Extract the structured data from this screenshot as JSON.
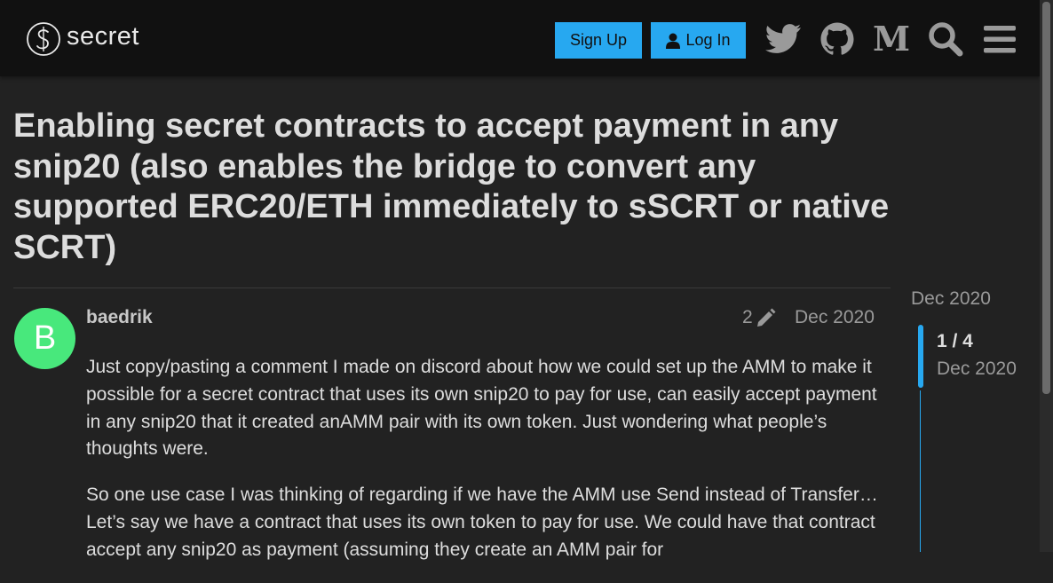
{
  "header": {
    "logo_text": "secret",
    "signup_label": "Sign Up",
    "login_label": "Log In",
    "icons": [
      "twitter-icon",
      "github-icon",
      "medium-icon",
      "search-icon",
      "hamburger-menu-icon"
    ]
  },
  "topic": {
    "title": "Enabling secret contracts to accept payment in any snip20 (also enables the bridge to convert any supported ERC20/ETH immediately to sSCRT or native SCRT)"
  },
  "post": {
    "avatar_letter": "B",
    "username": "baedrik",
    "edit_count": "2",
    "date": "Dec 2020",
    "paragraphs": [
      "Just copy/pasting a comment I made on discord about how we could set up the AMM to make it possible for a secret contract that uses its own snip20 to pay for use, can easily accept payment in any snip20 that it created anAMM pair with its own token. Just wondering what people’s thoughts were.",
      "So one use case I was thinking of regarding if we have the AMM use Send instead of Transfer…Let’s say we have a contract that uses its own token to pay for use. We could have that contract accept any snip20 as payment (assuming they create an AMM pair for"
    ]
  },
  "timeline": {
    "start_date": "Dec 2020",
    "position": "1 / 4",
    "current_date": "Dec 2020"
  },
  "colors": {
    "accent": "#27a8f0",
    "avatar": "#48e87c",
    "background": "#222222",
    "header": "#111111"
  }
}
